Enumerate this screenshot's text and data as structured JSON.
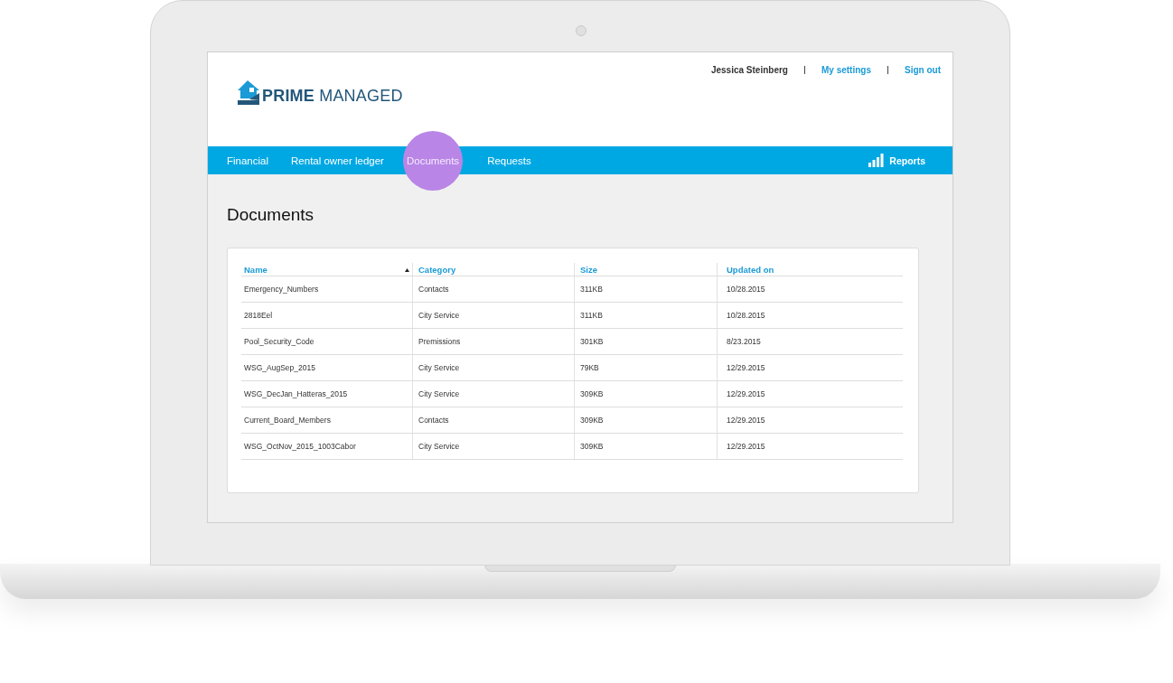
{
  "header": {
    "user": "Jessica Steinberg",
    "links": [
      "My settings",
      "Sign out"
    ],
    "logo": {
      "bold": "PRIME",
      "light": "MANAGED"
    }
  },
  "nav": {
    "tabs": [
      {
        "label": "Financial",
        "selected": false
      },
      {
        "label": "Rental owner ledger",
        "selected": false
      },
      {
        "label": "Documents",
        "selected": true
      },
      {
        "label": "Requests",
        "selected": false
      }
    ],
    "reports": "Reports"
  },
  "page": {
    "title": "Documents"
  },
  "table": {
    "columns": [
      {
        "label": "Name",
        "sorted": true
      },
      {
        "label": "Category",
        "sorted": false
      },
      {
        "label": "Size",
        "sorted": false
      },
      {
        "label": "Updated on",
        "sorted": false
      }
    ],
    "rows": [
      [
        "Emergency_Numbers",
        "Contacts",
        "311KB",
        "10/28.2015"
      ],
      [
        "2818Eel",
        "City Service",
        "311KB",
        "10/28.2015"
      ],
      [
        "Pool_Security_Code",
        "Premissions",
        "301KB",
        "8/23.2015"
      ],
      [
        "WSG_AugSep_2015",
        "City Service",
        "79KB",
        "12/29.2015"
      ],
      [
        "WSG_DecJan_Hatteras_2015",
        "City Service",
        "309KB",
        "12/29.2015"
      ],
      [
        "Current_Board_Members",
        "Contacts",
        "309KB",
        "12/29.2015"
      ],
      [
        "WSG_OctNov_2015_1003Cabor",
        "City Service",
        "309KB",
        "12/29.2015"
      ]
    ]
  }
}
